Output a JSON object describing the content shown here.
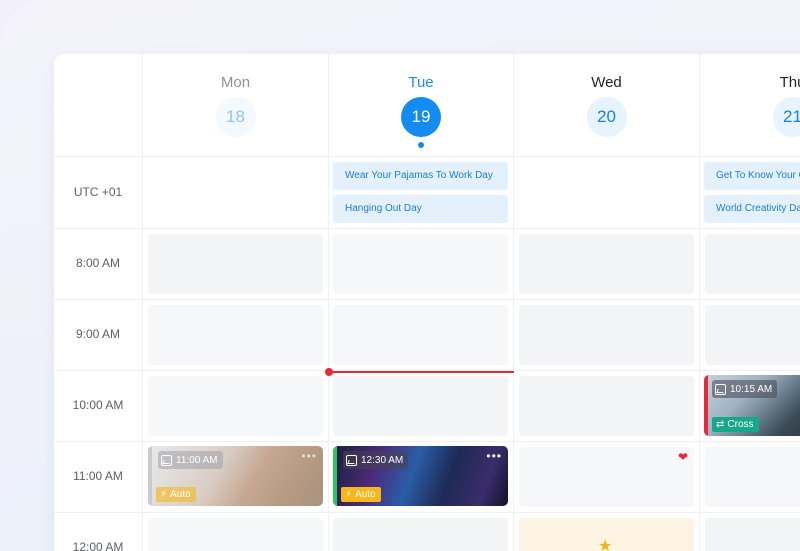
{
  "timezone": "UTC +01",
  "days": [
    {
      "name": "Mon",
      "num": "18"
    },
    {
      "name": "Tue",
      "num": "19"
    },
    {
      "name": "Wed",
      "num": "20"
    },
    {
      "name": "Thu",
      "num": "21"
    }
  ],
  "times": [
    "8:00 AM",
    "9:00 AM",
    "10:00 AM",
    "11:00 AM",
    "12:00 AM"
  ],
  "holidays": {
    "tue": [
      "Wear Your Pajamas To Work Day",
      "Hanging Out Day"
    ],
    "thu": [
      "Get To Know Your C",
      "World Creativity Da"
    ]
  },
  "posts": {
    "mon": {
      "time": "11:00 AM",
      "badge": "Auto"
    },
    "tue": {
      "time": "12:30 AM",
      "badge": "Auto"
    },
    "thu": {
      "time": "10:15 AM",
      "badge": "Cross"
    }
  },
  "colors": {
    "accent": "#148bf0",
    "now_line": "#e8273b",
    "auto_badge": "#f7b619",
    "cross_badge": "#17a88a"
  },
  "icons": {
    "more": "more-icon",
    "heart": "heart-icon",
    "star": "star-icon",
    "bolt": "bolt-icon",
    "image": "image-icon",
    "shuffle": "shuffle-icon"
  }
}
